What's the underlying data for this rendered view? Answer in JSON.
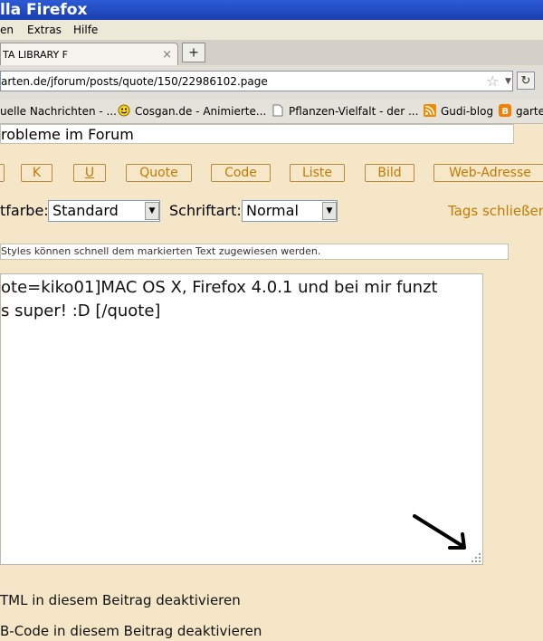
{
  "window": {
    "title": "lla Firefox"
  },
  "menu": {
    "items": [
      "en",
      "Extras",
      "Hilfe"
    ]
  },
  "tabs": [
    {
      "label": "TA LIBRARY F",
      "close": "×"
    }
  ],
  "new_tab": "+",
  "address": {
    "url": "arten.de/jforum/posts/quote/150/22986102.page"
  },
  "bookmarks": [
    {
      "label": "uelle Nachrichten - ...",
      "icon": "none"
    },
    {
      "label": "Cosgan.de - Animierte...",
      "icon": "smiley-icon"
    },
    {
      "label": "Pflanzen-Vielfalt - der ...",
      "icon": "page-icon"
    },
    {
      "label": "Gudi-blog",
      "icon": "rss-icon"
    },
    {
      "label": "garte",
      "icon": "blogger-icon"
    }
  ],
  "form": {
    "subject": "robleme im Forum",
    "buttons": [
      "K",
      "U",
      "Quote",
      "Code",
      "Liste",
      "Bild",
      "Web-Adresse"
    ],
    "color_label": "tfarbe:",
    "color_value": "Standard",
    "font_label": "Schriftart:",
    "font_value": "Normal",
    "tags_close": "Tags schließen",
    "hint": "Styles können schnell dem markierten Text zugewiesen werden.",
    "message_lines": [
      "ote=kiko01]MAC OS X, Firefox 4.0.1 und bei mir funzt",
      "s super!   :D [/quote]"
    ],
    "options": [
      "TML in diesem Beitrag deaktivieren",
      "B-Code in diesem Beitrag deaktivieren"
    ]
  },
  "colors": {
    "accent": "#c27a00",
    "page_bg": "#f6e6c8",
    "titlebar": "#2c5bd6"
  }
}
